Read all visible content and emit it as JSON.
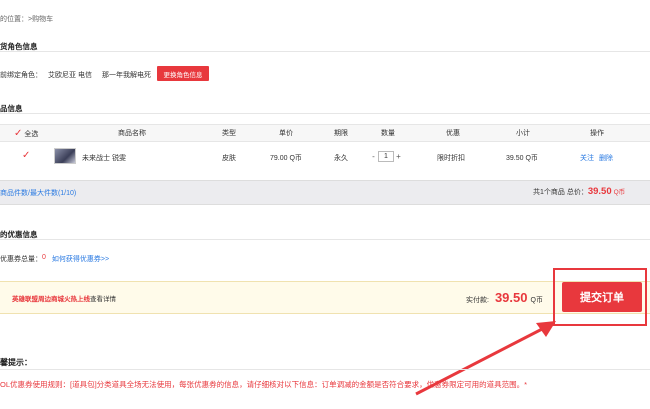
{
  "breadcrumb": "的位置：>购物车",
  "role_section": {
    "title": "货角色信息",
    "label": "前绑定角色：",
    "server": "艾欧尼亚 电信",
    "role_name": "那一年我解电死",
    "change_button": "更换角色信息"
  },
  "goods_section": {
    "title": "品信息",
    "columns": {
      "select_all": "全选",
      "name": "商品名称",
      "type": "类型",
      "price": "单价",
      "period": "期限",
      "qty": "数量",
      "discount": "优惠",
      "subtotal": "小计",
      "action": "操作"
    },
    "rows": [
      {
        "name": "未来战士 锐雯",
        "type": "皮肤",
        "price": "79.00 Q币",
        "period": "永久",
        "qty_minus": "-",
        "qty": "1",
        "qty_plus": "+",
        "discount": "限时折扣",
        "subtotal": "39.50 Q币",
        "follow": "关注",
        "delete": "删除"
      }
    ]
  },
  "summary": {
    "count_label": "商品件数/最大件数(1/10)",
    "total_prefix": "共1个商品 总价：",
    "total_value": "39.50",
    "total_unit": "Q币"
  },
  "coupon_section": {
    "title": "的优惠信息",
    "label": "优惠券总量：",
    "count": "0",
    "how_link": "如何获得优惠券>>"
  },
  "payment": {
    "promo_red": "英雄联盟周边商城火热上线",
    "promo_gray": "查看详情",
    "paid_label": "实付款:",
    "paid_value": "39.50",
    "paid_unit": "Q币",
    "submit_button": "提交订单"
  },
  "tips": {
    "title": "馨提示：",
    "text": "OL优惠券使用规则：[道具包]分类道具全场无法使用，每张优惠券的信息，请仔细核对以下信息：订单调减的金额是否符合要求，优惠券限定可用的道具范围。*"
  },
  "colors": {
    "accent": "#e8383d",
    "link": "#2a7ae2"
  }
}
